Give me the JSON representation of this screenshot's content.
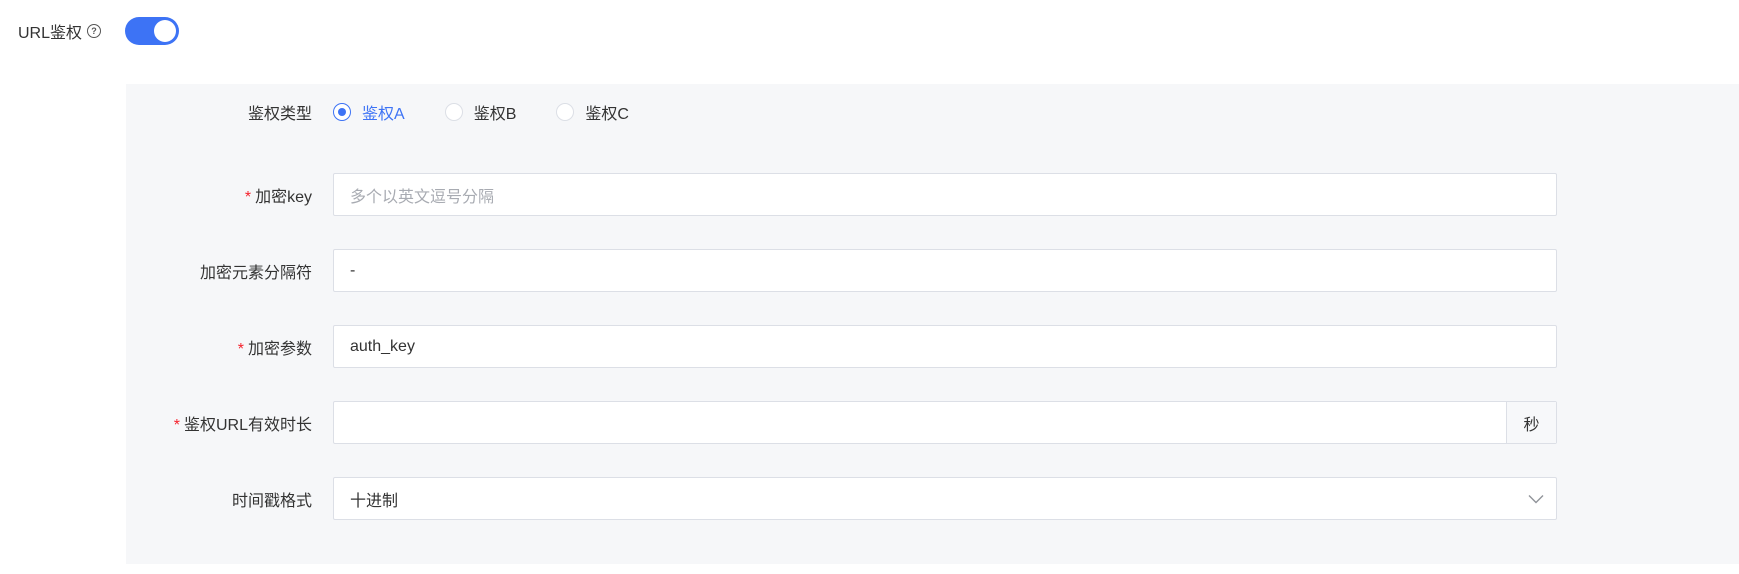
{
  "header": {
    "label": "URL鉴权",
    "help_icon": "question-circle-icon",
    "toggle_on": true,
    "accent_color": "#3d73f5"
  },
  "form": {
    "auth_type": {
      "label": "鉴权类型",
      "options": [
        "鉴权A",
        "鉴权B",
        "鉴权C"
      ],
      "selected": "鉴权A"
    },
    "encrypt_key": {
      "label": "加密key",
      "required": true,
      "value": "",
      "placeholder": "多个以英文逗号分隔"
    },
    "separator": {
      "label": "加密元素分隔符",
      "required": false,
      "value": "-"
    },
    "encrypt_param": {
      "label": "加密参数",
      "required": true,
      "value": "auth_key"
    },
    "valid_duration": {
      "label": "鉴权URL有效时长",
      "required": true,
      "value": "",
      "suffix": "秒"
    },
    "timestamp_format": {
      "label": "时间戳格式",
      "required": false,
      "value": "十进制",
      "icon": "chevron-down-icon"
    },
    "required_mark": "*"
  }
}
